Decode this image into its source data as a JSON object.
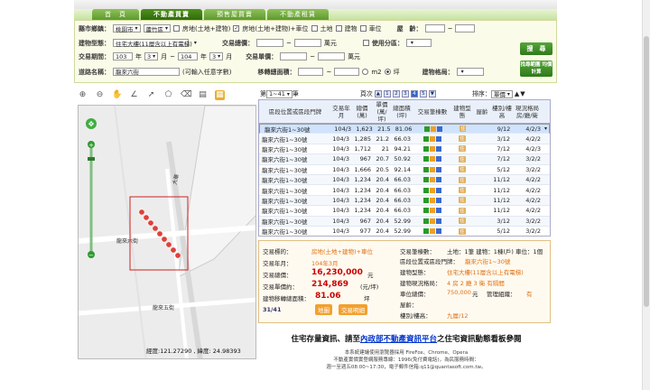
{
  "tabs": [
    "首　頁",
    "不動產買賣",
    "預售屋買賣",
    "不動產租賃"
  ],
  "search": {
    "county_label": "縣市鄉鎮：",
    "county": "桃園市",
    "town": "蘆竹區",
    "type_opts": [
      "房地(土地+建物)",
      "房地(土地+建物)+車位",
      "土地",
      "建物",
      "車位"
    ],
    "age_label": "屋　齡：",
    "age_sep": "~",
    "bldg_type_label": "建物型態：",
    "bldg_type": "住宅大樓(11層含以上有電梯)",
    "total_label": "交易總價：",
    "total_unit": "萬元",
    "use_zone_label": "使用分區：",
    "search_btn": "搜　尋",
    "period_label": "交易期間：",
    "from_year": "103",
    "from_month": "3",
    "to_year": "104",
    "to_month": "3",
    "year_unit": "年",
    "month_unit": "月",
    "unit_price_label": "交易單價：",
    "unit_price_unit": "萬元",
    "road_label": "道路名稱：",
    "road_value": "龍來六街",
    "road_hint": "(可輸入任意字數)",
    "area_label": "移轉總面積：",
    "area_unit1": "m2",
    "area_unit2": "坪",
    "layout_label": "建物格局：",
    "search_method_btn": "找尋範圍 均價計算"
  },
  "map": {
    "coord_text": "經度:121.27290 , 緯度: 24.98393",
    "road_labels": [
      "大華",
      "龍來六街",
      "龍來五街"
    ]
  },
  "pager": {
    "prefix": "第",
    "range": "1~41",
    "suffix": "筆",
    "pages_label": "頁次",
    "pages": [
      "1",
      "2",
      "3",
      "4",
      "5"
    ],
    "current_page": "4",
    "sort_label": "排序：",
    "sort_value": "單價"
  },
  "table": {
    "headers": [
      "區段位置或區段門牌",
      "交易年月",
      "總價(萬)",
      "單價(萬/坪)",
      "總面積(坪)",
      "交易筆棟數",
      "建物型態",
      "屋齡",
      "樓別/樓高",
      "現況格局房/廳/衛"
    ],
    "rows": [
      {
        "addr": "龍來六街1~30號",
        "ym": "104/3",
        "total": "1,623",
        "unit": "21.5",
        "area": "81.06",
        "floor": "9/12",
        "layout": "4/2/3"
      },
      {
        "addr": "龍來六街1~30號",
        "ym": "104/3",
        "total": "1,285",
        "unit": "21.2",
        "area": "66.03",
        "floor": "3/12",
        "layout": "4/2/2"
      },
      {
        "addr": "龍來六街1~30號",
        "ym": "104/3",
        "total": "1,712",
        "unit": "21",
        "area": "94.21",
        "floor": "7/12",
        "layout": "4/2/3"
      },
      {
        "addr": "龍來六街1~30號",
        "ym": "104/3",
        "total": "967",
        "unit": "20.7",
        "area": "50.92",
        "floor": "7/12",
        "layout": "3/2/2"
      },
      {
        "addr": "龍來六街1~30號",
        "ym": "104/3",
        "total": "1,666",
        "unit": "20.5",
        "area": "92.14",
        "floor": "5/12",
        "layout": "3/2/2"
      },
      {
        "addr": "龍來六街1~30號",
        "ym": "104/3",
        "total": "1,234",
        "unit": "20.4",
        "area": "66.03",
        "floor": "11/12",
        "layout": "4/2/2"
      },
      {
        "addr": "龍來六街1~30號",
        "ym": "104/3",
        "total": "1,234",
        "unit": "20.4",
        "area": "66.03",
        "floor": "11/12",
        "layout": "4/2/2"
      },
      {
        "addr": "龍來六街1~30號",
        "ym": "104/3",
        "total": "1,234",
        "unit": "20.4",
        "area": "66.03",
        "floor": "11/12",
        "layout": "4/2/2"
      },
      {
        "addr": "龍來六街1~30號",
        "ym": "104/3",
        "total": "1,234",
        "unit": "20.4",
        "area": "66.03",
        "floor": "11/12",
        "layout": "4/2/2"
      },
      {
        "addr": "龍來六街1~30號",
        "ym": "104/3",
        "total": "967",
        "unit": "20.4",
        "area": "52.99",
        "floor": "3/12",
        "layout": "3/2/2"
      },
      {
        "addr": "龍來六街1~30號",
        "ym": "104/3",
        "total": "977",
        "unit": "20.4",
        "area": "52.99",
        "floor": "5/12",
        "layout": "3/2/2"
      }
    ],
    "tag_text": "住"
  },
  "detail": {
    "target_label": "交易標的：",
    "target_value": "房地(土地+建物)+車位",
    "date_label": "交易年月：",
    "date_value": "104年3月",
    "total_label": "交易總價：",
    "total_value": "16,230,000",
    "total_unit": "元",
    "unit_label": "交易單價約：",
    "unit_value": "214,869",
    "unit_unit": "(元/坪)",
    "area_label": "建物移轉總面積：",
    "area_value": "81.06",
    "area_unit": "坪",
    "count": "31/41",
    "map_btn": "地圖",
    "desc_btn": "交易明細",
    "pieces_label": "交易筆棟數：",
    "pieces_value": "土地：1筆 建物：1棟(戶) 車位：1個",
    "addr_label": "區段位置或區段門牌：",
    "addr_value": "龍來六街1~30號",
    "btype_label": "建物型態：",
    "btype_value": "住宅大樓(11層含以上有電梯)",
    "layout_label": "建物現況格局：",
    "layout_value": "4 房 2 廳 3 衛 有隔間",
    "parking_label": "車位總價：",
    "parking_value": "750,000",
    "parking_unit": "元",
    "mgmt_label": "管理組織：",
    "mgmt_value": "有",
    "age_label": "屋齡：",
    "floor_label": "樓別/樓高：",
    "floor_value": "九層/12"
  },
  "banner": {
    "pre": "住宅存量資訊、請至",
    "link": "內政部不動產資訊平台",
    "post": "之住宅資訊動態看板參閱"
  },
  "footer": [
    "本系統建議使用瀏覽器採用 FireFox、Chrome、Opera",
    "不動產實價實登網服務專線：1996(免付費電話)，為民服務時間：",
    "週一至週五08:00~17:30，電子郵件信箱:q11@quantasoft.com.tw。"
  ],
  "colors": {
    "green": "#3f8a1c",
    "selected_row": "#cfe3ff",
    "price_red": "#cc0000"
  }
}
